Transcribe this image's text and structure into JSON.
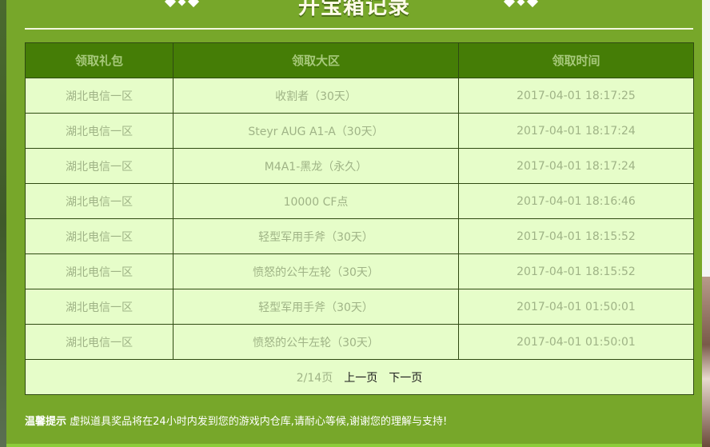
{
  "title": "开宝箱记录",
  "colors": {
    "panel": "#77a72a",
    "header_bg": "#457d06",
    "header_text": "#a7c97b",
    "cell_bg": "#e6fdc9",
    "cell_text": "#9fb386"
  },
  "table": {
    "headers": [
      "领取礼包",
      "领取大区",
      "领取时间"
    ],
    "rows": [
      [
        "湖北电信一区",
        "收割者（30天）",
        "2017-04-01 18:17:25"
      ],
      [
        "湖北电信一区",
        "Steyr AUG A1-A（30天）",
        "2017-04-01 18:17:24"
      ],
      [
        "湖北电信一区",
        "M4A1-黑龙（永久）",
        "2017-04-01 18:17:24"
      ],
      [
        "湖北电信一区",
        "10000 CF点",
        "2017-04-01 18:16:46"
      ],
      [
        "湖北电信一区",
        "轻型军用手斧（30天）",
        "2017-04-01 18:15:52"
      ],
      [
        "湖北电信一区",
        "愤怒的公牛左轮（30天）",
        "2017-04-01 18:15:52"
      ],
      [
        "湖北电信一区",
        "轻型军用手斧（30天）",
        "2017-04-01 01:50:01"
      ],
      [
        "湖北电信一区",
        "愤怒的公牛左轮（30天）",
        "2017-04-01 01:50:01"
      ]
    ]
  },
  "pagination": {
    "page_count": "2/14页",
    "prev_label": "上一页",
    "next_label": "下一页"
  },
  "tip": {
    "label": "温馨提示",
    "text": " 虚拟道具奖品将在24小时内发到您的游戏内仓库,请耐心等候,谢谢您的理解与支持!"
  }
}
